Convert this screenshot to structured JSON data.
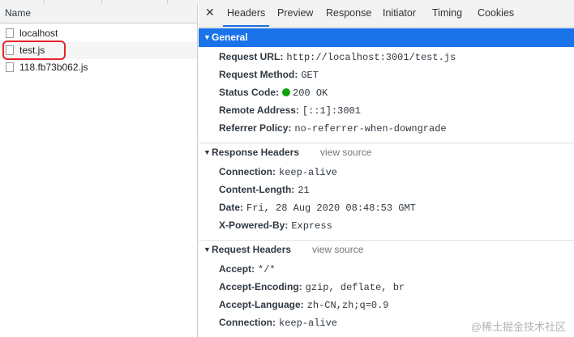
{
  "file_list": {
    "column_header": "Name",
    "files": [
      {
        "name": "localhost"
      },
      {
        "name": "test.js"
      },
      {
        "name": "118.fb73b062.js"
      }
    ]
  },
  "tabs": {
    "close_glyph": "✕",
    "items": [
      {
        "label": "Headers"
      },
      {
        "label": "Preview"
      },
      {
        "label": "Response"
      },
      {
        "label": "Initiator"
      },
      {
        "label": "Timing"
      },
      {
        "label": "Cookies"
      }
    ],
    "active": "Headers"
  },
  "general": {
    "title": "General",
    "rows": [
      {
        "key": "Request URL:",
        "value": "http://localhost:3001/test.js"
      },
      {
        "key": "Request Method:",
        "value": "GET"
      },
      {
        "key": "Status Code:",
        "value": "200 OK"
      },
      {
        "key": "Remote Address:",
        "value": "[::1]:3001"
      },
      {
        "key": "Referrer Policy:",
        "value": "no-referrer-when-downgrade"
      }
    ]
  },
  "response_headers": {
    "title": "Response Headers",
    "view_source": "view source",
    "rows": [
      {
        "key": "Connection:",
        "value": "keep-alive"
      },
      {
        "key": "Content-Length:",
        "value": "21"
      },
      {
        "key": "Date:",
        "value": "Fri, 28 Aug 2020 08:48:53 GMT"
      },
      {
        "key": "X-Powered-By:",
        "value": "Express"
      }
    ]
  },
  "request_headers": {
    "title": "Request Headers",
    "view_source": "view source",
    "rows": [
      {
        "key": "Accept:",
        "value": "*/*"
      },
      {
        "key": "Accept-Encoding:",
        "value": "gzip, deflate, br"
      },
      {
        "key": "Accept-Language:",
        "value": "zh-CN,zh;q=0.9"
      },
      {
        "key": "Connection:",
        "value": "keep-alive"
      }
    ]
  },
  "watermark": "@稀土掘金技术社区",
  "colors": {
    "accent": "#1a73e8",
    "status_ok": "#0da30d",
    "highlight": "#e8232a"
  }
}
